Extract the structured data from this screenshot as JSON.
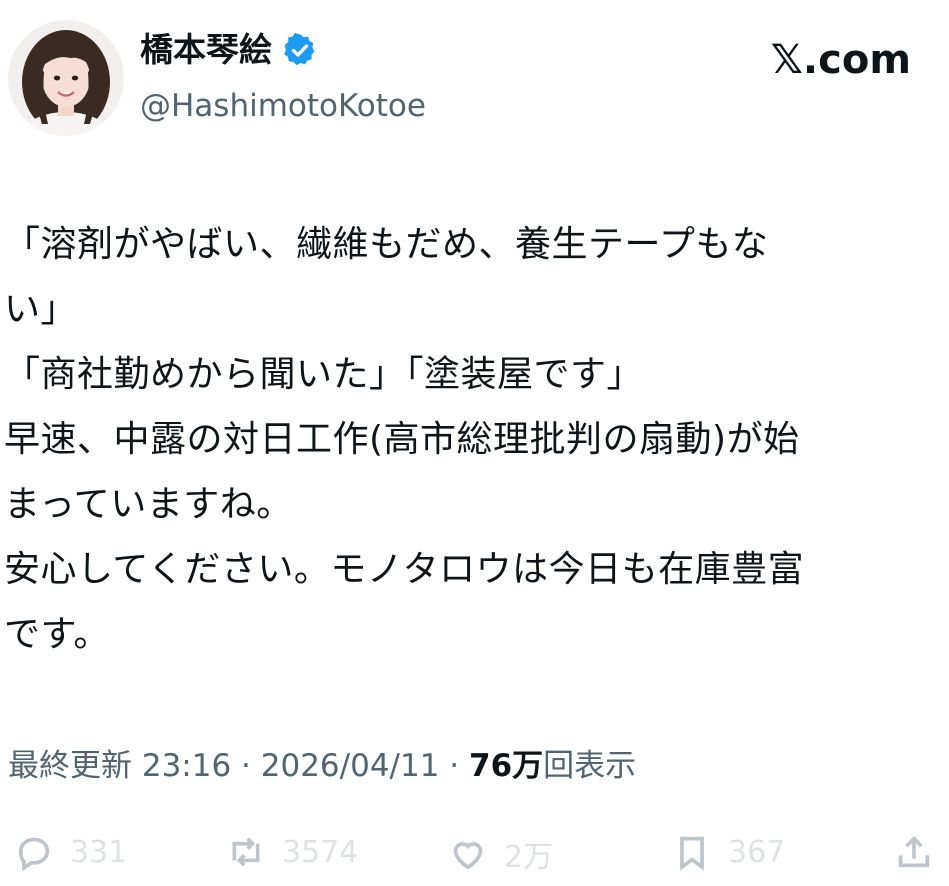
{
  "author": {
    "display_name": "橋本琴絵",
    "handle": "@HashimotoKotoe",
    "verified_icon": "verified-badge-icon",
    "verified_color": "#1d9bf0"
  },
  "brand": "𝕏.com",
  "tweet": {
    "lines": [
      "「溶剤がやばい、繊維もだめ、養生テープもな",
      "い」",
      "「商社勤めから聞いた」「塗装屋です」",
      "早速、中露の対日工作(高市総理批判の扇動)が始",
      "まっていますね。",
      "安心してください。モノタロウは今日も在庫豊富",
      "です。"
    ]
  },
  "meta": {
    "prefix": "最終更新 23:16 · 2026/04/11 ·",
    "views_count": "76万",
    "views_label": "回表示"
  },
  "actions": {
    "reply": {
      "icon": "reply-icon",
      "count": "331"
    },
    "repost": {
      "icon": "repost-icon",
      "count": "3574"
    },
    "like": {
      "icon": "heart-icon",
      "count": "2万"
    },
    "bookmark": {
      "icon": "bookmark-icon",
      "count": "367"
    },
    "share": {
      "icon": "share-icon"
    }
  }
}
